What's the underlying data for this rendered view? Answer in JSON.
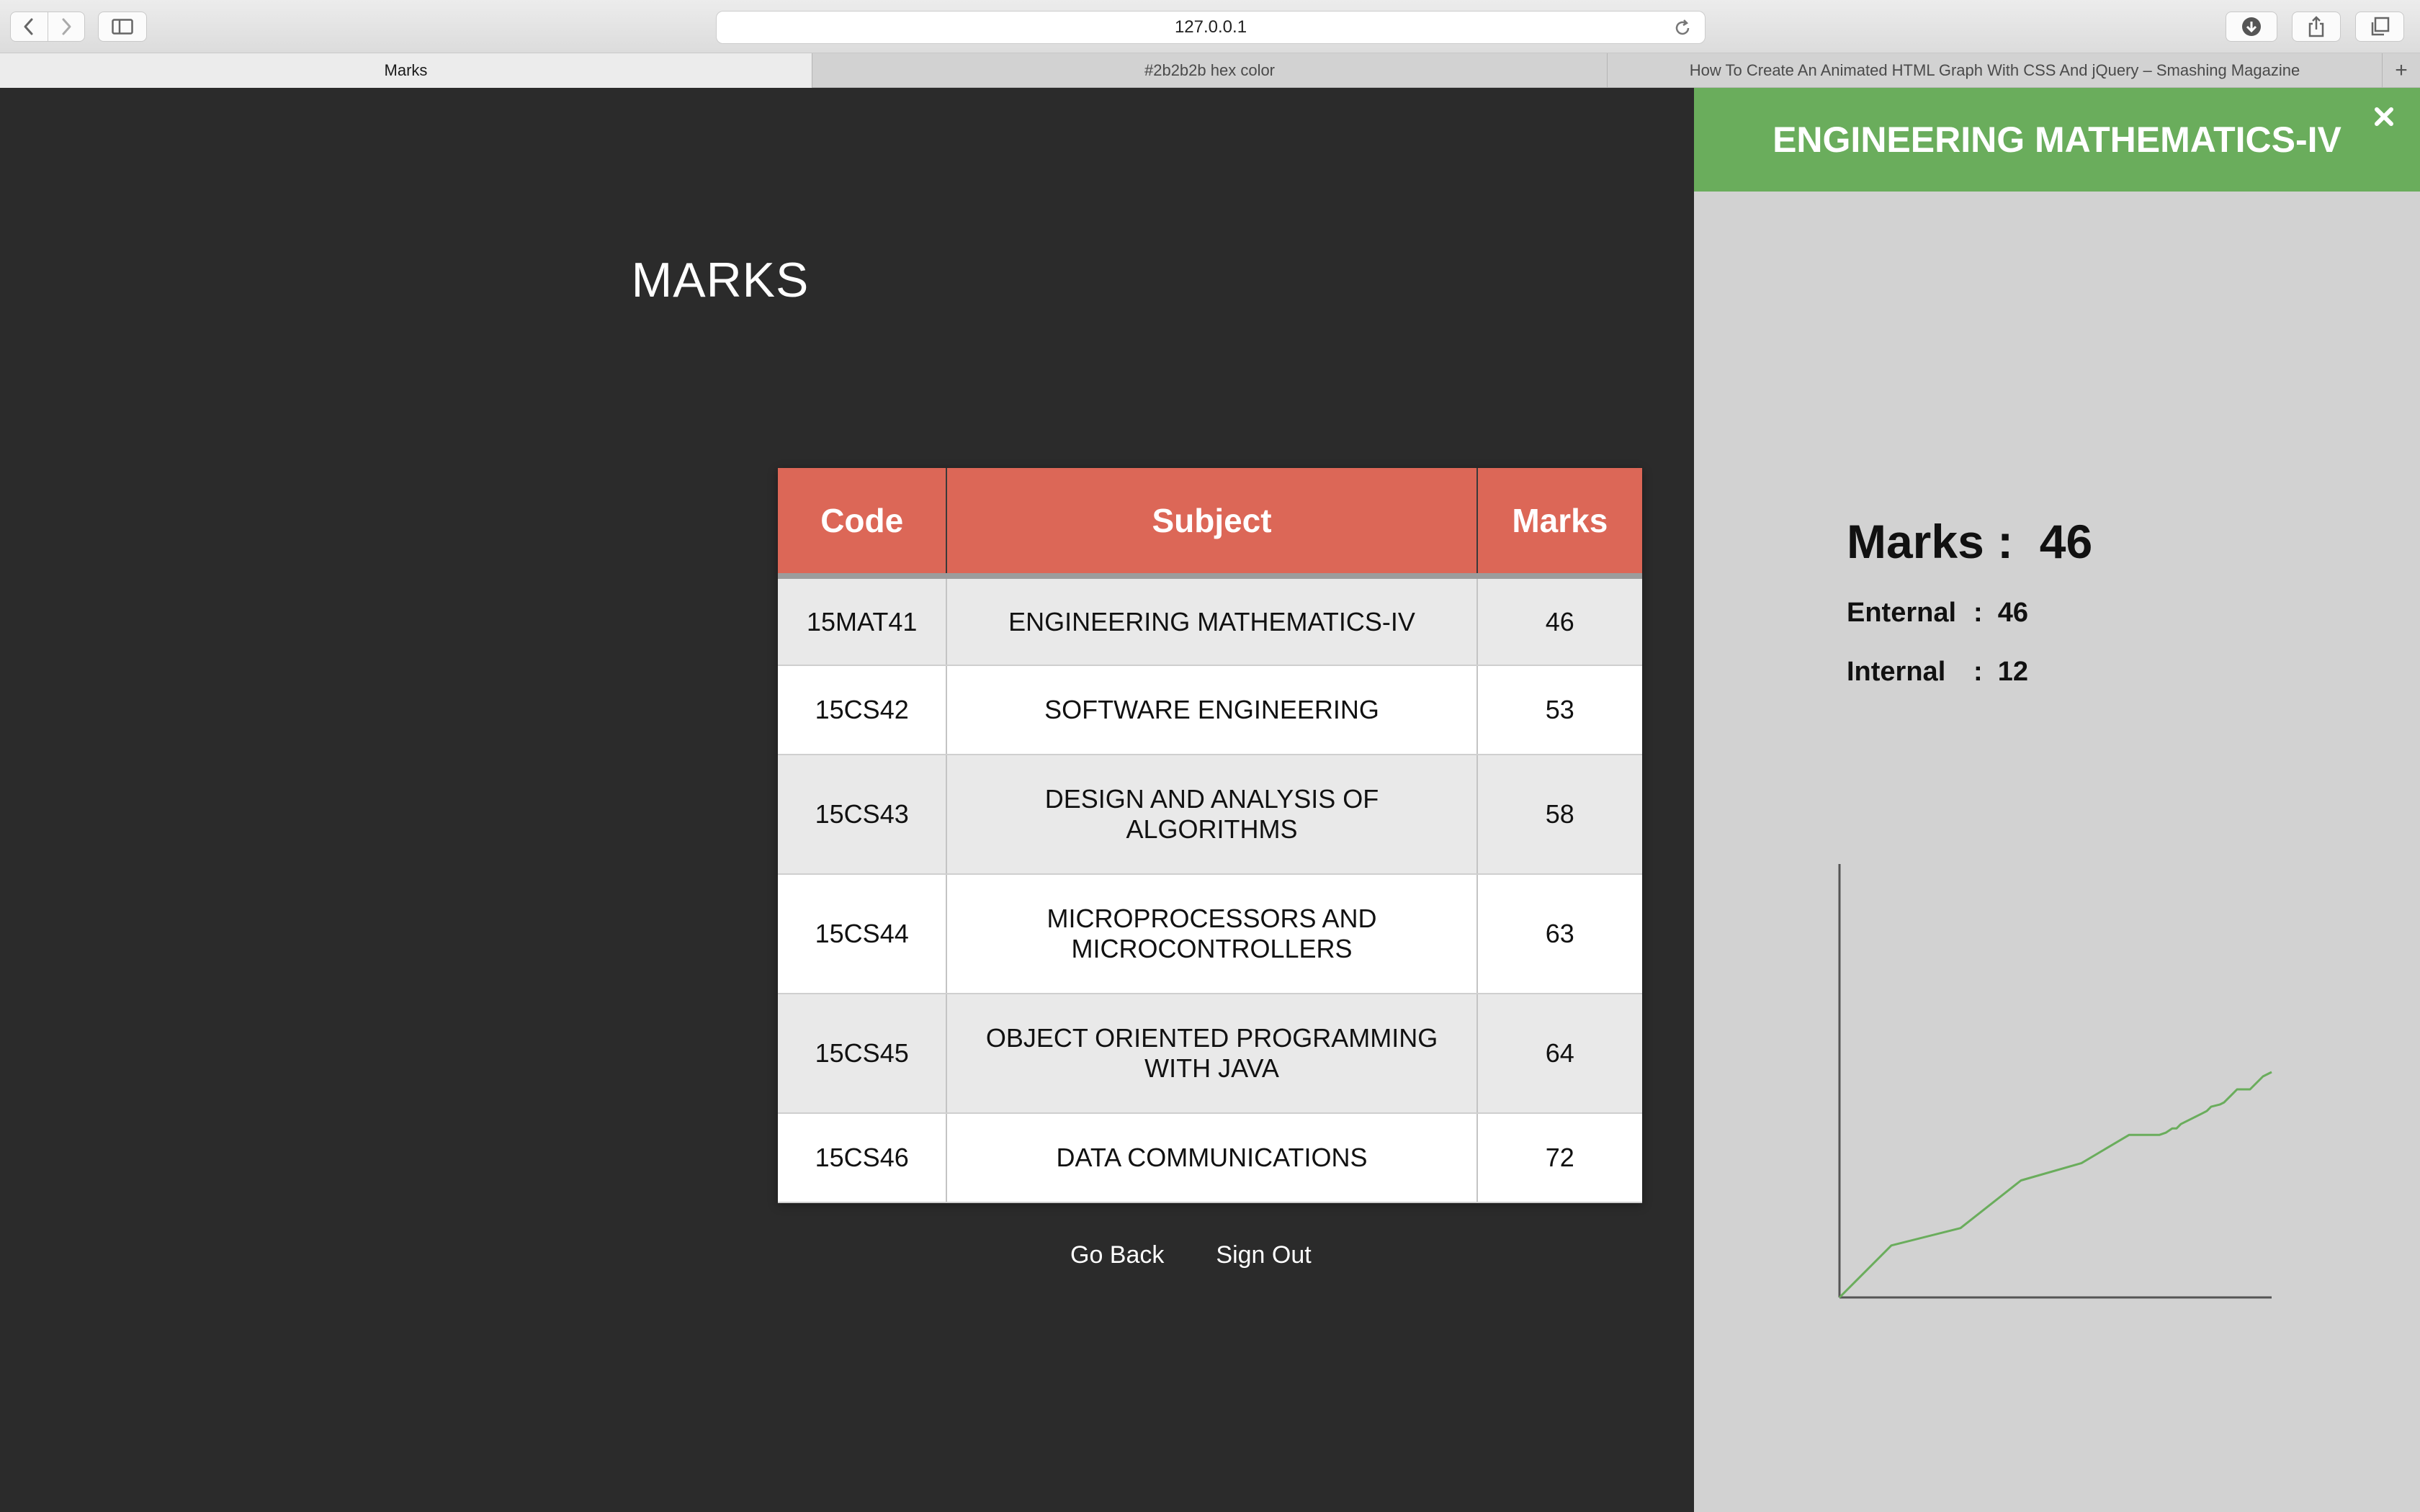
{
  "browser": {
    "url": "127.0.0.1",
    "tabs": [
      {
        "label": "Marks",
        "active": true
      },
      {
        "label": "#2b2b2b hex color",
        "active": false
      },
      {
        "label": "How To Create An Animated HTML Graph With CSS And jQuery – Smashing Magazine",
        "active": false
      }
    ]
  },
  "page": {
    "title": "MARKS",
    "table": {
      "headers": [
        "Code",
        "Subject",
        "Marks"
      ],
      "rows": [
        {
          "code": "15MAT41",
          "subject": "ENGINEERING MATHEMATICS-IV",
          "marks": "46"
        },
        {
          "code": "15CS42",
          "subject": "SOFTWARE ENGINEERING",
          "marks": "53"
        },
        {
          "code": "15CS43",
          "subject": "DESIGN AND ANALYSIS OF ALGORITHMS",
          "marks": "58"
        },
        {
          "code": "15CS44",
          "subject": "MICROPROCESSORS AND MICROCONTROLLERS",
          "marks": "63"
        },
        {
          "code": "15CS45",
          "subject": "OBJECT ORIENTED PROGRAMMING WITH JAVA",
          "marks": "64"
        },
        {
          "code": "15CS46",
          "subject": "DATA COMMUNICATIONS",
          "marks": "72"
        }
      ]
    },
    "go_back": "Go Back",
    "sign_out": "Sign Out"
  },
  "panel": {
    "title": "ENGINEERING MATHEMATICS-IV",
    "marks_label": "Marks :  46",
    "enternal_label": "Enternal",
    "enternal_value": ":  46",
    "internal_label": "Internal",
    "internal_value": ":  12",
    "accent_color": "#6aad5c"
  },
  "colors": {
    "background": "#2b2b2b",
    "table_header": "#dc6757",
    "panel_bg": "#d2d2d2",
    "graph_line": "#6aad5c"
  },
  "chart_data": {
    "type": "line",
    "title": "",
    "xlabel": "",
    "ylabel": "",
    "xlim": [
      0,
      1
    ],
    "ylim": [
      0,
      1
    ],
    "series": [
      {
        "x": [
          0,
          0.12,
          0.28,
          0.42,
          0.56,
          0.67,
          0.74,
          0.755,
          0.77,
          0.78,
          0.79,
          0.8,
          0.81,
          0.83,
          0.84,
          0.85,
          0.86,
          0.88,
          0.89,
          0.9,
          0.91,
          0.92,
          0.93,
          0.95,
          0.96,
          0.97,
          0.98,
          1.0
        ],
        "y": [
          0,
          0.12,
          0.16,
          0.27,
          0.31,
          0.375,
          0.375,
          0.38,
          0.39,
          0.39,
          0.4,
          0.405,
          0.41,
          0.42,
          0.425,
          0.43,
          0.44,
          0.445,
          0.45,
          0.46,
          0.47,
          0.48,
          0.48,
          0.48,
          0.49,
          0.5,
          0.51,
          0.52
        ]
      }
    ]
  }
}
